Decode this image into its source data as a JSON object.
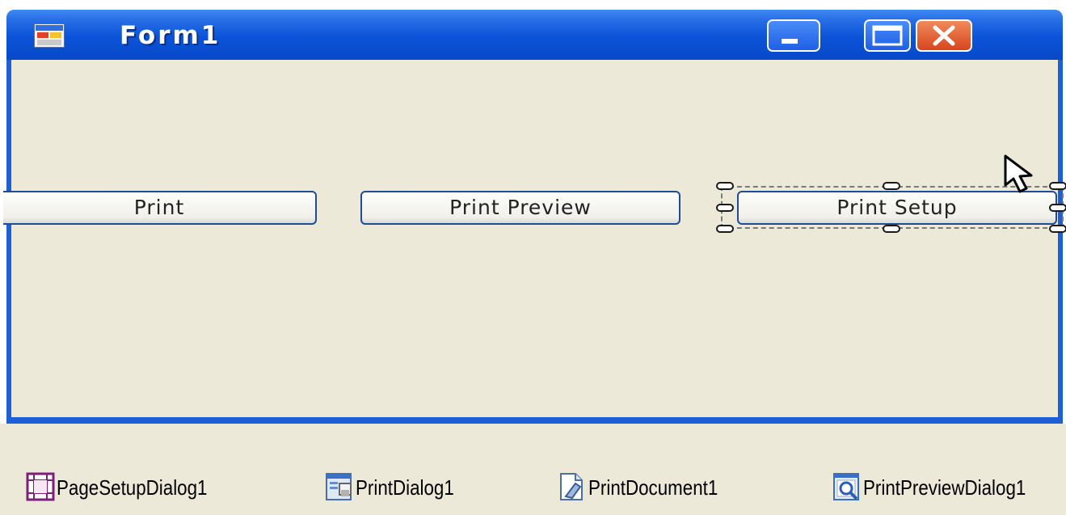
{
  "window": {
    "title": "Form1",
    "title_bar_color": "#0a53d8",
    "client_background": "#ece9d8"
  },
  "title_bar_buttons": [
    {
      "name": "minimize",
      "icon": "minimize-icon"
    },
    {
      "name": "maximize",
      "icon": "maximize-icon"
    },
    {
      "name": "close",
      "icon": "close-icon"
    }
  ],
  "form_buttons": {
    "print": "Print",
    "print_preview": "Print Preview",
    "print_setup": "Print Setup"
  },
  "selected_control": "Print Setup",
  "component_tray": {
    "items": [
      {
        "label": "PageSetupDialog1",
        "icon": "page-setup-dialog-icon"
      },
      {
        "label": "PrintDialog1",
        "icon": "print-dialog-icon"
      },
      {
        "label": "PrintDocument1",
        "icon": "print-document-icon"
      },
      {
        "label": "PrintPreviewDialog1",
        "icon": "print-preview-dialog-icon"
      }
    ]
  }
}
